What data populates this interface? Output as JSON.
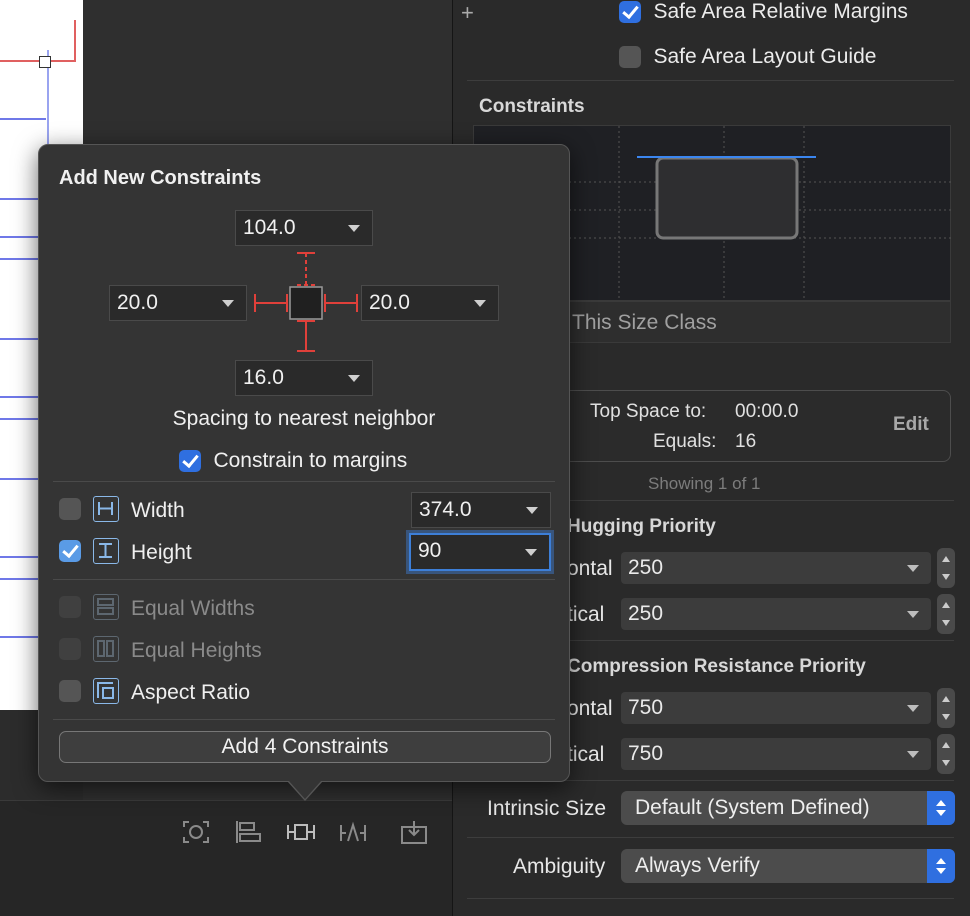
{
  "inspector": {
    "safe_area_margins_label": "Safe Area Relative Margins",
    "safe_area_guide_label": "Safe Area Layout Guide",
    "constraints_heading": "Constraints",
    "size_class_label": "This Size Class",
    "constraint_card": {
      "line1_key": "Top Space to:",
      "line1_value": "00:00.0",
      "line2_key": "Equals:",
      "line2_value": "16",
      "edit_label": "Edit"
    },
    "showing_label": "Showing 1 of 1",
    "hugging_heading": "Hugging Priority",
    "hugging_h_label": "ontal",
    "hugging_h_value": "250",
    "hugging_v_label": "tical",
    "hugging_v_value": "250",
    "compression_heading": "Compression Resistance Priority",
    "compression_h_label": "ontal",
    "compression_h_value": "750",
    "compression_v_label": "tical",
    "compression_v_value": "750",
    "intrinsic_label": "Intrinsic Size",
    "intrinsic_value": "Default (System Defined)",
    "ambiguity_label": "Ambiguity",
    "ambiguity_value": "Always Verify"
  },
  "popover": {
    "title": "Add New Constraints",
    "top_value": "104.0",
    "leading_value": "20.0",
    "trailing_value": "20.0",
    "bottom_value": "16.0",
    "spacing_label": "Spacing to nearest neighbor",
    "constrain_margins_label": "Constrain to margins",
    "width_label": "Width",
    "width_value": "374.0",
    "height_label": "Height",
    "height_value": "90",
    "equal_widths_label": "Equal Widths",
    "equal_heights_label": "Equal Heights",
    "aspect_ratio_label": "Aspect Ratio",
    "add_button_label": "Add 4 Constraints"
  },
  "colors": {
    "accent": "#2f6fe0",
    "constraint_red": "#e0403a",
    "focus_ring": "#3d7fd8"
  }
}
